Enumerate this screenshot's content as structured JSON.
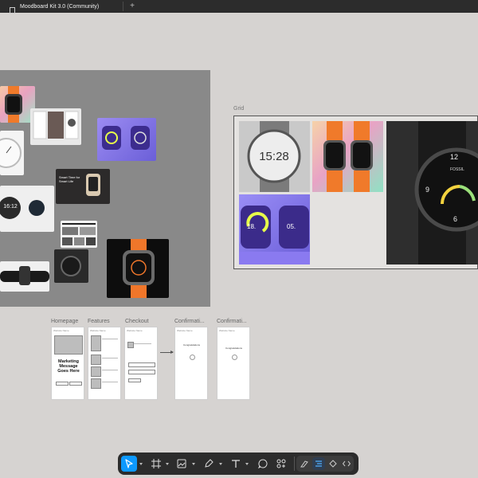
{
  "tab": {
    "title": "Moodboard Kit 3.0 (Community)",
    "add_label": "+"
  },
  "grid": {
    "label": "Grid",
    "watch_time": "15:28",
    "purple_left": "18.",
    "purple_right": "05.",
    "fossil_hour_top": "12",
    "fossil_hour_left": "9",
    "fossil_hour_bottom": "6",
    "fossil_brand": "FOSSIL"
  },
  "moodboard": {
    "watch_time": "16:12",
    "banner_text": "Smart Time for Smart Life"
  },
  "wireframes": [
    {
      "label": "Homepage",
      "message": "Marketing Message Goes Here"
    },
    {
      "label": "Features"
    },
    {
      "label": "Checkout"
    },
    {
      "label": "Confirmati..."
    },
    {
      "label": "Confirmati..."
    }
  ],
  "wireframe_header": "Website Name",
  "wireframe_success": "Congratulations",
  "toolbar": {
    "tools": [
      "move",
      "frame",
      "image",
      "pen",
      "text",
      "comment",
      "actions"
    ],
    "modes": [
      "draw",
      "design",
      "prototype",
      "dev-mode"
    ],
    "accent": "#0d99ff"
  }
}
